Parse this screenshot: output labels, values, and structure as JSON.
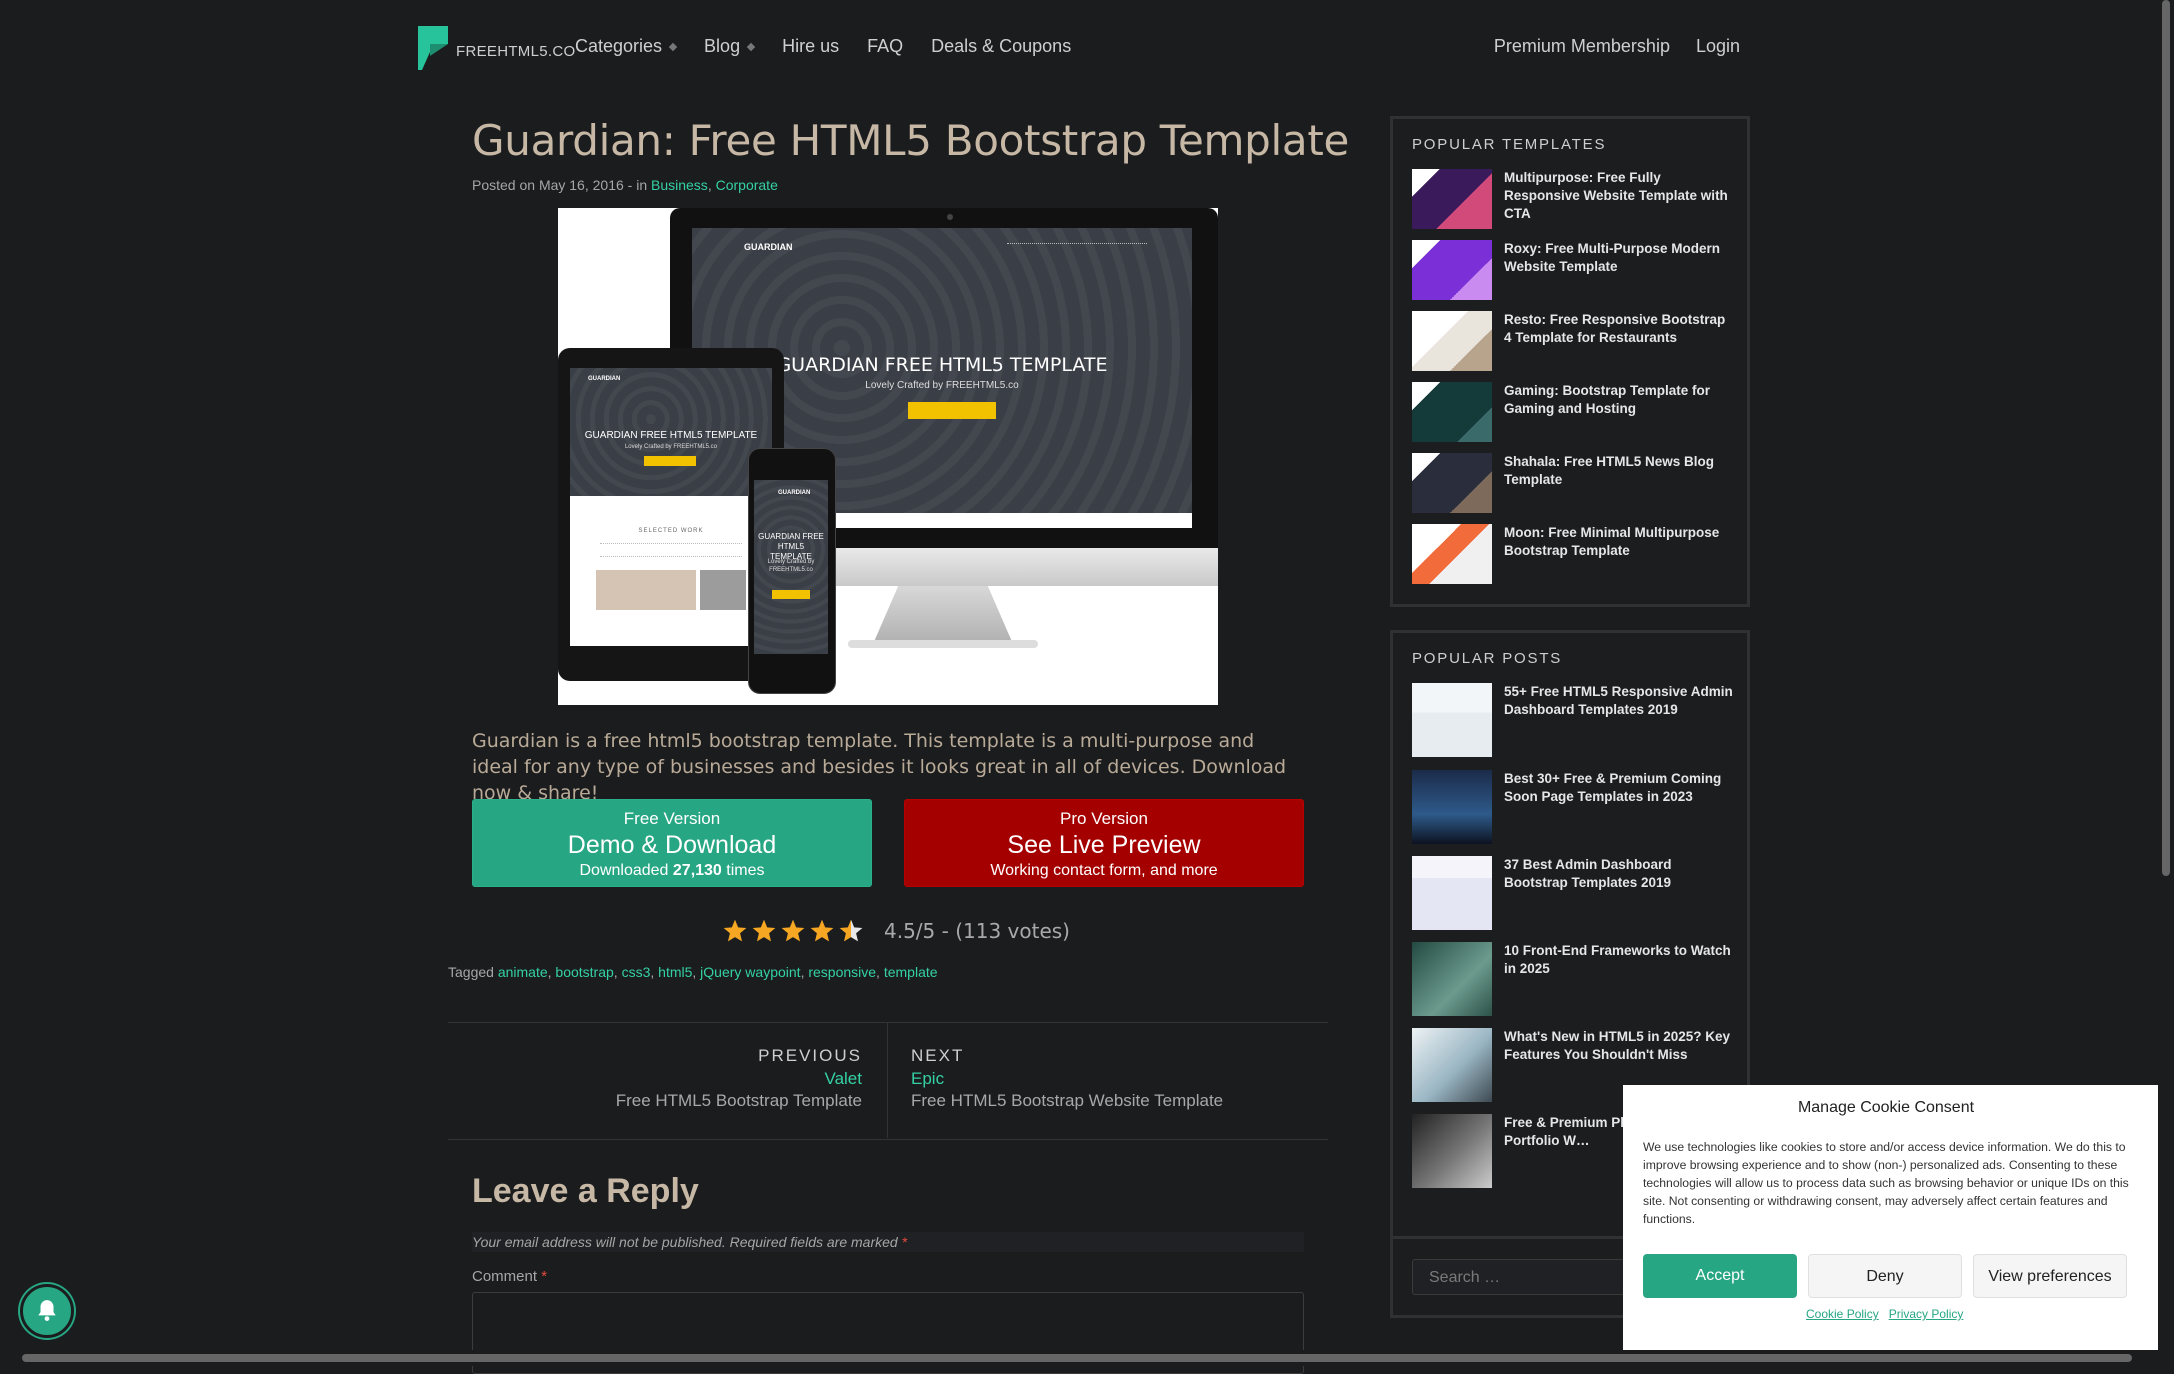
{
  "header": {
    "logo_text": "FREEHTML5.CO",
    "nav": [
      "Categories",
      "Blog",
      "Hire us",
      "FAQ",
      "Deals & Coupons"
    ],
    "nav_right": [
      "Premium Membership",
      "Login"
    ]
  },
  "post": {
    "title": "Guardian: Free HTML5 Bootstrap Template",
    "posted_prefix": "Posted on May 16, 2016 - in ",
    "categories": [
      "Business",
      "Corporate"
    ],
    "hero": {
      "desktop_title": "GUARDIAN FREE HTML5 TEMPLATE",
      "desktop_sub": "Lovely Crafted by FREEHTML5.co",
      "tablet_title": "GUARDIAN FREE HTML5 TEMPLATE",
      "tablet_sub": "Lovely Crafted by FREEHTML5.co",
      "tablet_section": "SELECTED WORK",
      "phone_title": "GUARDIAN FREE HTML5 TEMPLATE",
      "phone_sub": "Lovely Crafted by FREEHTML5.co",
      "brand": "GUARDIAN"
    },
    "description": "Guardian is a free html5 bootstrap template. This template is a multi-purpose and ideal for any type of businesses and besides it looks great in all of devices. Download now & share!",
    "free_btn": {
      "small": "Free Version",
      "big": "Demo & Download",
      "sub_prefix": "Downloaded ",
      "count": "27,130",
      "sub_suffix": " times"
    },
    "pro_btn": {
      "small": "Pro Version",
      "big": "See Live Preview",
      "sub": "Working contact form, and more"
    },
    "rating": {
      "score": 4.5,
      "max": 5,
      "text": "4.5/5 - (113 votes)"
    },
    "tagged_label": "Tagged ",
    "tags": [
      "animate",
      "bootstrap",
      "css3",
      "html5",
      "jQuery waypoint",
      "responsive",
      "template"
    ],
    "prev": {
      "label": "PREVIOUS",
      "name": "Valet",
      "sub": "Free HTML5 Bootstrap Template"
    },
    "next": {
      "label": "NEXT",
      "name": "Epic",
      "sub": "Free HTML5 Bootstrap Website Template"
    }
  },
  "reply": {
    "title": "Leave a Reply",
    "note": "Your email address will not be published. Required fields are marked ",
    "required_mark": "*",
    "comment_label": "Comment "
  },
  "sidebar": {
    "popular_templates_title": "POPULAR TEMPLATES",
    "popular_templates": [
      "Multipurpose: Free Fully Responsive Website Template with CTA",
      "Roxy: Free Multi-Purpose Modern Website Template",
      "Resto: Free Responsive Bootstrap 4 Template for Restaurants",
      "Gaming: Bootstrap Template for Gaming and Hosting",
      "Shahala: Free HTML5 News Blog Template",
      "Moon: Free Minimal Multipurpose Bootstrap Template"
    ],
    "popular_posts_title": "POPULAR POSTS",
    "popular_posts": [
      "55+ Free HTML5 Responsive Admin Dashboard Templates 2019",
      "Best 30+ Free & Premium Coming Soon Page Templates in 2023",
      "37 Best Admin Dashboard Bootstrap Templates 2019",
      "10 Front-End Frameworks to Watch in 2025",
      "What's New in HTML5 in 2025? Key Features You Shouldn't Miss",
      "Free & Premium Ph… Creative Portfolio W…"
    ],
    "search_placeholder": "Search …"
  },
  "cookie": {
    "title": "Manage Cookie Consent",
    "text": "We use technologies like cookies to store and/or access device information. We do this to improve browsing experience and to show (non-) personalized ads. Consenting to these technologies will allow us to process data such as browsing behavior or unique IDs on this site. Not consenting or withdrawing consent, may adversely affect certain features and functions.",
    "accept": "Accept",
    "deny": "Deny",
    "view": "View preferences",
    "cookie_policy": "Cookie Policy",
    "privacy_policy": "Privacy Policy"
  },
  "colors": {
    "accent": "#27a683",
    "link": "#34d1a4",
    "pro": "#a50000",
    "background": "#1b1c1e",
    "title": "#c7b8a6",
    "star": "#f5a623"
  },
  "icons": [
    "logo-icon",
    "diamond-icon",
    "star-icon",
    "bell-icon"
  ]
}
